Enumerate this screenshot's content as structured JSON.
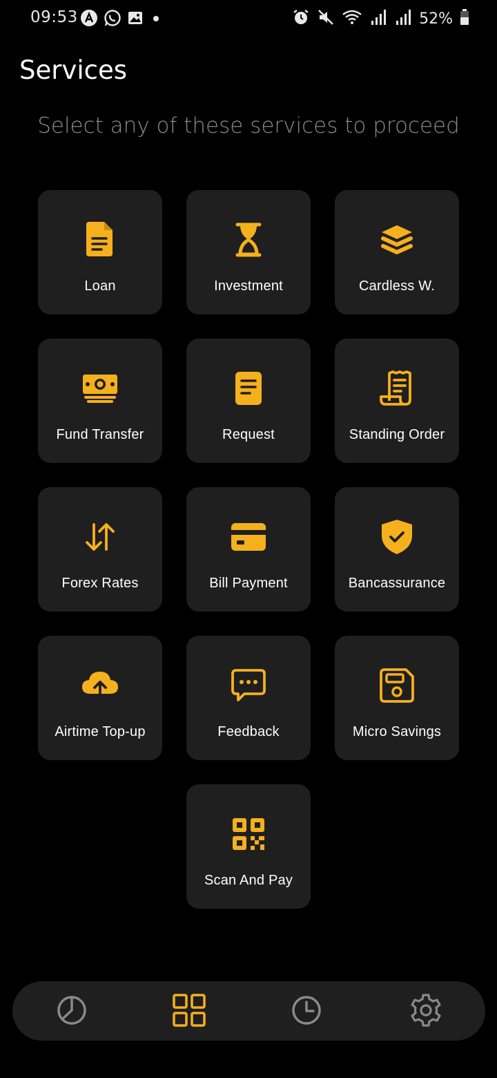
{
  "status_bar": {
    "time": "09:53",
    "battery_percent": "52%",
    "icons_left": [
      "app-a-icon",
      "whatsapp-icon",
      "gallery-icon",
      "dot-icon"
    ],
    "icons_right": [
      "alarm-icon",
      "mute-icon",
      "wifi-icon",
      "signal-icon",
      "signal-icon",
      "battery-icon"
    ]
  },
  "header": {
    "title": "Services",
    "subtitle": "Select any of these services to proceed"
  },
  "colors": {
    "background": "#000000",
    "tile_background": "#1f1f1f",
    "accent": "#f5b01e",
    "subtitle_text": "#8c8c8c",
    "nav_icon_inactive": "#8a8a8a"
  },
  "services": [
    {
      "label": "Loan",
      "icon": "document-icon"
    },
    {
      "label": "Investment",
      "icon": "hourglass-icon"
    },
    {
      "label": "Cardless W.",
      "icon": "layers-icon"
    },
    {
      "label": "Fund Transfer",
      "icon": "money-icon"
    },
    {
      "label": "Request",
      "icon": "note-icon"
    },
    {
      "label": "Standing Order",
      "icon": "receipt-icon"
    },
    {
      "label": "Forex Rates",
      "icon": "swap-arrows-icon"
    },
    {
      "label": "Bill Payment",
      "icon": "credit-card-icon"
    },
    {
      "label": "Bancassurance",
      "icon": "shield-check-icon"
    },
    {
      "label": "Airtime Top-up",
      "icon": "cloud-upload-icon"
    },
    {
      "label": "Feedback",
      "icon": "chat-icon"
    },
    {
      "label": "Micro Savings",
      "icon": "floppy-icon"
    },
    {
      "label": "Scan And Pay",
      "icon": "qr-code-icon"
    }
  ],
  "bottom_nav": {
    "items": [
      {
        "icon": "pie-chart-icon",
        "active": false
      },
      {
        "icon": "grid-icon",
        "active": true
      },
      {
        "icon": "clock-icon",
        "active": false
      },
      {
        "icon": "gear-icon",
        "active": false
      }
    ]
  }
}
